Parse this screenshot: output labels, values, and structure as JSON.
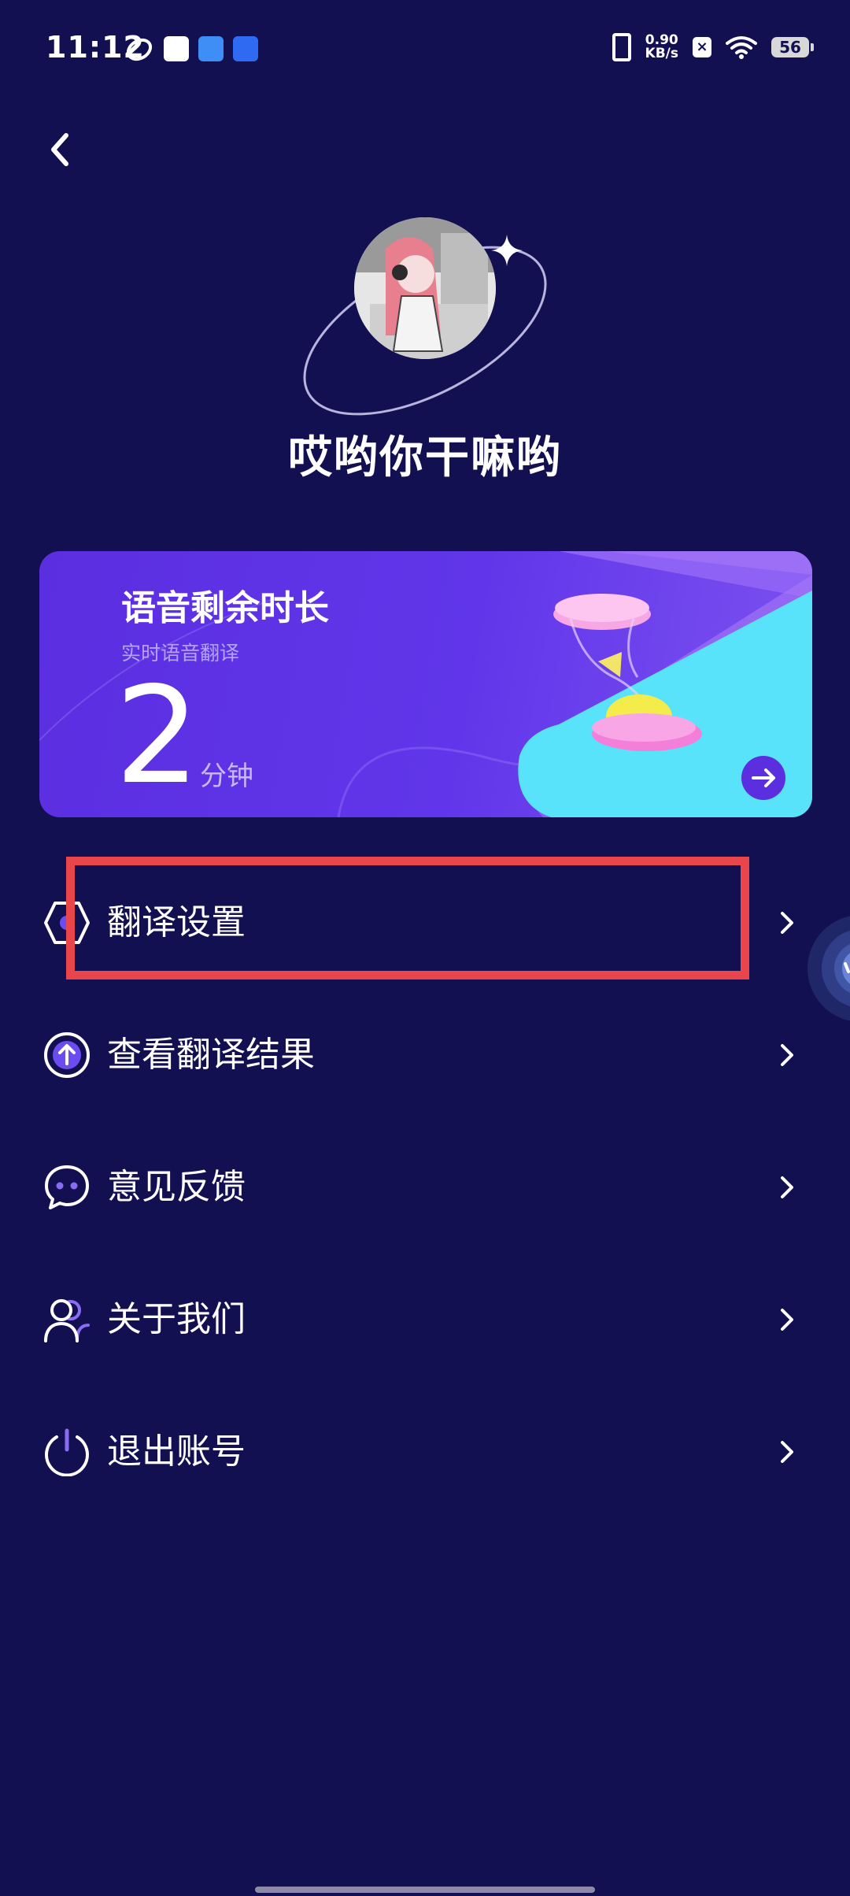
{
  "status_bar": {
    "time": "11:12",
    "net_speed_value": "0.90",
    "net_speed_unit": "KB/s",
    "box_label": "×",
    "battery_level": "56"
  },
  "profile": {
    "username": "哎哟你干嘛哟"
  },
  "voice_card": {
    "title": "语音剩余时长",
    "subtitle": "实时语音翻译",
    "value": "2",
    "unit": "分钟"
  },
  "menu": {
    "items": [
      {
        "label": "翻译设置",
        "icon": "hexagon-settings-icon"
      },
      {
        "label": "查看翻译结果",
        "icon": "upload-circle-icon"
      },
      {
        "label": "意见反馈",
        "icon": "chat-bubble-icon"
      },
      {
        "label": "关于我们",
        "icon": "users-icon"
      },
      {
        "label": "退出账号",
        "icon": "power-icon"
      }
    ]
  },
  "colors": {
    "background": "#131052",
    "accent": "#5b2fe0",
    "highlight": "#e8464b"
  }
}
